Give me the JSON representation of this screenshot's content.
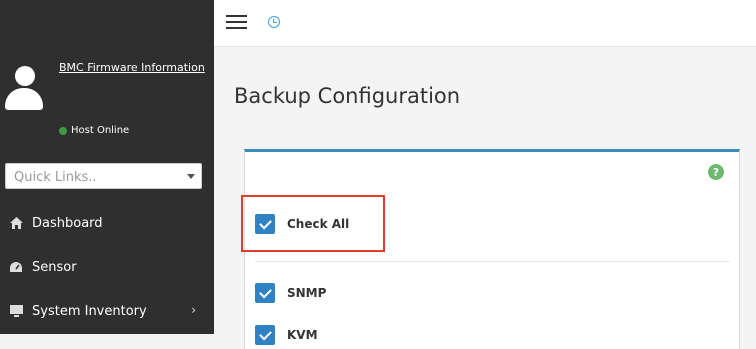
{
  "sidebar": {
    "firmware_link": "BMC Firmware Information",
    "host_status": "Host Online",
    "status_color": "#3f9b3f",
    "quick_links_placeholder": "Quick Links..",
    "items": [
      {
        "label": "Dashboard",
        "icon": "home-icon"
      },
      {
        "label": "Sensor",
        "icon": "gauge-icon"
      },
      {
        "label": "System Inventory",
        "icon": "monitor-icon"
      }
    ]
  },
  "main": {
    "title": "Backup Configuration",
    "check_all_label": "Check All",
    "options": [
      {
        "label": "SNMP",
        "checked": true
      },
      {
        "label": "KVM",
        "checked": true
      }
    ]
  },
  "colors": {
    "accent": "#3c8dbc",
    "checkbox": "#2f82c4",
    "highlight": "#e53c2a",
    "sidebar_bg": "#2f2f2f"
  }
}
